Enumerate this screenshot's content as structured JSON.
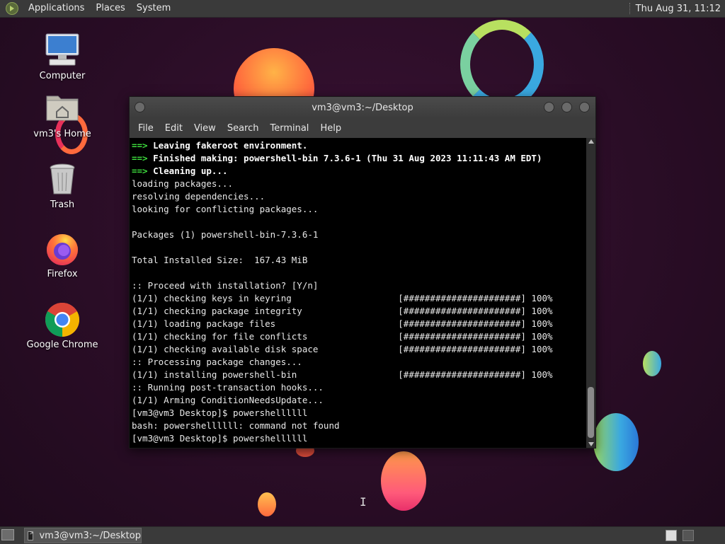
{
  "top_panel": {
    "menus": [
      "Applications",
      "Places",
      "System"
    ],
    "clock": "Thu Aug 31, 11:12"
  },
  "desktop_icons": [
    {
      "label": "Computer",
      "icon": "computer-icon"
    },
    {
      "label": "vm3's Home",
      "icon": "home-folder-icon"
    },
    {
      "label": "Trash",
      "icon": "trash-icon"
    },
    {
      "label": "Firefox",
      "icon": "firefox-icon"
    },
    {
      "label": "Google Chrome",
      "icon": "chrome-icon"
    }
  ],
  "terminal": {
    "title": "vm3@vm3:~/Desktop",
    "menu": [
      "File",
      "Edit",
      "View",
      "Search",
      "Terminal",
      "Help"
    ],
    "lines": [
      {
        "arrow": "==> ",
        "text": "Leaving fakeroot environment.",
        "bold": true
      },
      {
        "arrow": "==> ",
        "text": "Finished making: powershell-bin 7.3.6-1 (Thu 31 Aug 2023 11:11:43 AM EDT)",
        "bold": true
      },
      {
        "arrow": "==> ",
        "text": "Cleaning up...",
        "bold": true
      },
      {
        "arrow": "",
        "text": "loading packages...",
        "bold": false
      },
      {
        "arrow": "",
        "text": "resolving dependencies...",
        "bold": false
      },
      {
        "arrow": "",
        "text": "looking for conflicting packages...",
        "bold": false
      },
      {
        "arrow": "",
        "text": "",
        "bold": false
      },
      {
        "arrow": "",
        "text": "Packages (1) powershell-bin-7.3.6-1",
        "bold": false
      },
      {
        "arrow": "",
        "text": "",
        "bold": false
      },
      {
        "arrow": "",
        "text": "Total Installed Size:  167.43 MiB",
        "bold": false
      },
      {
        "arrow": "",
        "text": "",
        "bold": false
      },
      {
        "arrow": "",
        "text": ":: Proceed with installation? [Y/n]",
        "bold": false
      },
      {
        "arrow": "",
        "text": "(1/1) checking keys in keyring                    [######################] 100%",
        "bold": false
      },
      {
        "arrow": "",
        "text": "(1/1) checking package integrity                  [######################] 100%",
        "bold": false
      },
      {
        "arrow": "",
        "text": "(1/1) loading package files                       [######################] 100%",
        "bold": false
      },
      {
        "arrow": "",
        "text": "(1/1) checking for file conflicts                 [######################] 100%",
        "bold": false
      },
      {
        "arrow": "",
        "text": "(1/1) checking available disk space               [######################] 100%",
        "bold": false
      },
      {
        "arrow": "",
        "text": ":: Processing package changes...",
        "bold": false
      },
      {
        "arrow": "",
        "text": "(1/1) installing powershell-bin                   [######################] 100%",
        "bold": false
      },
      {
        "arrow": "",
        "text": ":: Running post-transaction hooks...",
        "bold": false
      },
      {
        "arrow": "",
        "text": "(1/1) Arming ConditionNeedsUpdate...",
        "bold": false
      },
      {
        "arrow": "",
        "text": "[vm3@vm3 Desktop]$ powershellllll",
        "bold": false
      },
      {
        "arrow": "",
        "text": "bash: powershellllll: command not found",
        "bold": false
      },
      {
        "arrow": "",
        "text": "[vm3@vm3 Desktop]$ powershellllll",
        "bold": false
      }
    ]
  },
  "taskbar": {
    "window_button": "vm3@vm3:~/Desktop"
  },
  "colors": {
    "arrow_green": "#3ddc3d",
    "panel": "#3a3a3a",
    "background": "#2a0d26"
  }
}
